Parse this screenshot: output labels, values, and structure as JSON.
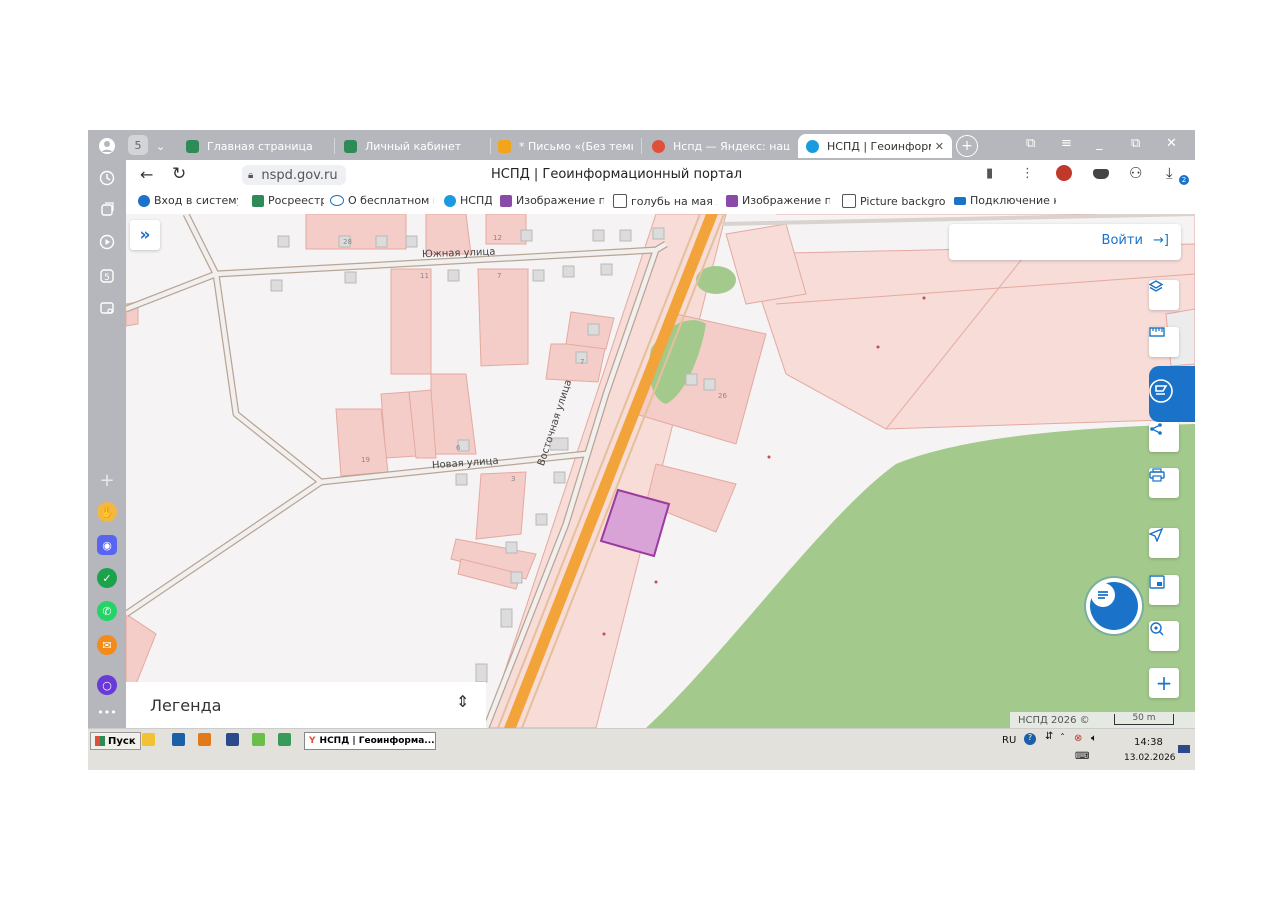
{
  "browser": {
    "tabs": [
      {
        "label": "Главная страница",
        "color": "#2e8b57"
      },
      {
        "label": "Личный кабинет",
        "color": "#2e8b57"
      },
      {
        "label": "* Письмо «(Без темы)»",
        "color": "#f2a51a"
      },
      {
        "label": "Нспд — Яндекс: нашлос",
        "color": "#e04f3a"
      },
      {
        "label": "НСПД | Геоинформац",
        "color": "#1a9be0",
        "active": true
      }
    ],
    "sidebar_badge": "5",
    "url": "nspd.gov.ru",
    "page_title": "НСПД | Геоинформационный портал",
    "download_badge": "2",
    "bookmarks": [
      "Вход в систему ::",
      "Росреестр",
      "О бесплатном пр",
      "НСПД",
      "Изображение пи",
      "голубь на мая лес",
      "Изображение пи",
      "Picture backgroun",
      "Подключение к в"
    ]
  },
  "map": {
    "login_label": "Войти",
    "legend_label": "Легенда",
    "copyright": "НСПД 2026 ©",
    "scale_label": "50 m",
    "streets": {
      "south": "Южная улица",
      "new": "Новая улица",
      "east": "Восточная улица"
    },
    "house_numbers": [
      "28",
      "12",
      "11",
      "7",
      "7",
      "26",
      "6",
      "19",
      "3"
    ],
    "colors": {
      "accent": "#1a73c8",
      "parcel": "#f4cdc8",
      "forest": "#a3c98c",
      "highway": "#f2a33a",
      "selected": "#d9a3d8"
    }
  },
  "taskbar": {
    "start_label": "Пуск",
    "task_label": "НСПД | Геоинформа...",
    "lang": "RU",
    "time": "14:38",
    "date": "13.02.2026"
  }
}
